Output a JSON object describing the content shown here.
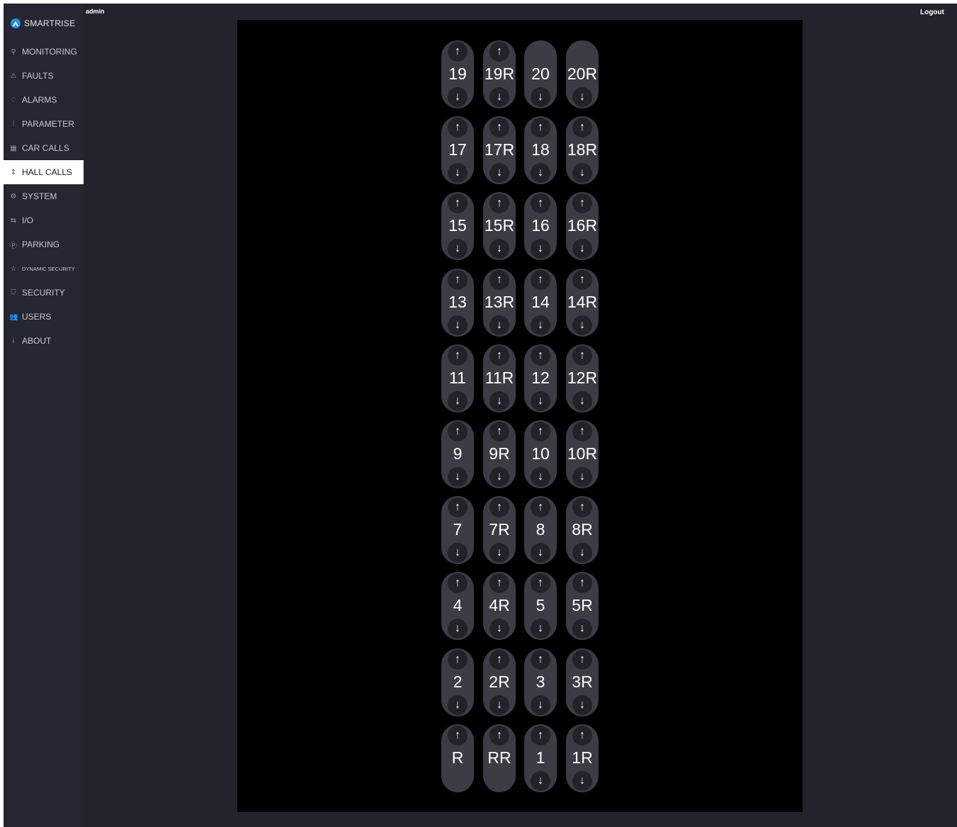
{
  "header": {
    "user": "admin",
    "logout_label": "Logout"
  },
  "brand": {
    "name": "SMARTRISE"
  },
  "sidebar": {
    "items": [
      {
        "label": "MONITORING",
        "icon": "search-icon",
        "glyph": "⚲"
      },
      {
        "label": "FAULTS",
        "icon": "warning-icon",
        "glyph": "⚠"
      },
      {
        "label": "ALARMS",
        "icon": "bell-icon",
        "glyph": "♢"
      },
      {
        "label": "PARAMETER",
        "icon": "sliders-icon",
        "glyph": "⫶"
      },
      {
        "label": "CAR CALLS",
        "icon": "keypad-icon",
        "glyph": "▦"
      },
      {
        "label": "HALL CALLS",
        "icon": "up-down-icon",
        "glyph": "⇕",
        "active": true
      },
      {
        "label": "SYSTEM",
        "icon": "gear-icon",
        "glyph": "⚙"
      },
      {
        "label": "I/O",
        "icon": "swap-icon",
        "glyph": "⇆"
      },
      {
        "label": "PARKING",
        "icon": "parking-icon",
        "glyph": "Ⓟ"
      },
      {
        "label": "DYNAMIC SECURITY",
        "icon": "star-icon",
        "glyph": "☆"
      },
      {
        "label": "SECURITY",
        "icon": "shield-icon",
        "glyph": "⛉"
      },
      {
        "label": "USERS",
        "icon": "users-icon",
        "glyph": "👥"
      },
      {
        "label": "ABOUT",
        "icon": "info-icon",
        "glyph": "i"
      }
    ]
  },
  "hall_calls": {
    "up_glyph": "↑",
    "down_glyph": "↓",
    "rows": [
      [
        {
          "label": "19",
          "up": true,
          "down": true
        },
        {
          "label": "19R",
          "up": true,
          "down": true
        },
        {
          "label": "20",
          "up": false,
          "down": true
        },
        {
          "label": "20R",
          "up": false,
          "down": true
        }
      ],
      [
        {
          "label": "17",
          "up": true,
          "down": true
        },
        {
          "label": "17R",
          "up": true,
          "down": true
        },
        {
          "label": "18",
          "up": true,
          "down": true
        },
        {
          "label": "18R",
          "up": true,
          "down": true
        }
      ],
      [
        {
          "label": "15",
          "up": true,
          "down": true
        },
        {
          "label": "15R",
          "up": true,
          "down": true
        },
        {
          "label": "16",
          "up": true,
          "down": true
        },
        {
          "label": "16R",
          "up": true,
          "down": true
        }
      ],
      [
        {
          "label": "13",
          "up": true,
          "down": true
        },
        {
          "label": "13R",
          "up": true,
          "down": true
        },
        {
          "label": "14",
          "up": true,
          "down": true
        },
        {
          "label": "14R",
          "up": true,
          "down": true
        }
      ],
      [
        {
          "label": "11",
          "up": true,
          "down": true
        },
        {
          "label": "11R",
          "up": true,
          "down": true
        },
        {
          "label": "12",
          "up": true,
          "down": true
        },
        {
          "label": "12R",
          "up": true,
          "down": true
        }
      ],
      [
        {
          "label": "9",
          "up": true,
          "down": true
        },
        {
          "label": "9R",
          "up": true,
          "down": true
        },
        {
          "label": "10",
          "up": true,
          "down": true
        },
        {
          "label": "10R",
          "up": true,
          "down": true
        }
      ],
      [
        {
          "label": "7",
          "up": true,
          "down": true
        },
        {
          "label": "7R",
          "up": true,
          "down": true
        },
        {
          "label": "8",
          "up": true,
          "down": true
        },
        {
          "label": "8R",
          "up": true,
          "down": true
        }
      ],
      [
        {
          "label": "4",
          "up": true,
          "down": true
        },
        {
          "label": "4R",
          "up": true,
          "down": true
        },
        {
          "label": "5",
          "up": true,
          "down": true
        },
        {
          "label": "5R",
          "up": true,
          "down": true
        }
      ],
      [
        {
          "label": "2",
          "up": true,
          "down": true
        },
        {
          "label": "2R",
          "up": true,
          "down": true
        },
        {
          "label": "3",
          "up": true,
          "down": true
        },
        {
          "label": "3R",
          "up": true,
          "down": true
        }
      ],
      [
        {
          "label": "R",
          "up": true,
          "down": false
        },
        {
          "label": "RR",
          "up": true,
          "down": false
        },
        {
          "label": "1",
          "up": true,
          "down": true
        },
        {
          "label": "1R",
          "up": true,
          "down": true
        }
      ]
    ]
  }
}
